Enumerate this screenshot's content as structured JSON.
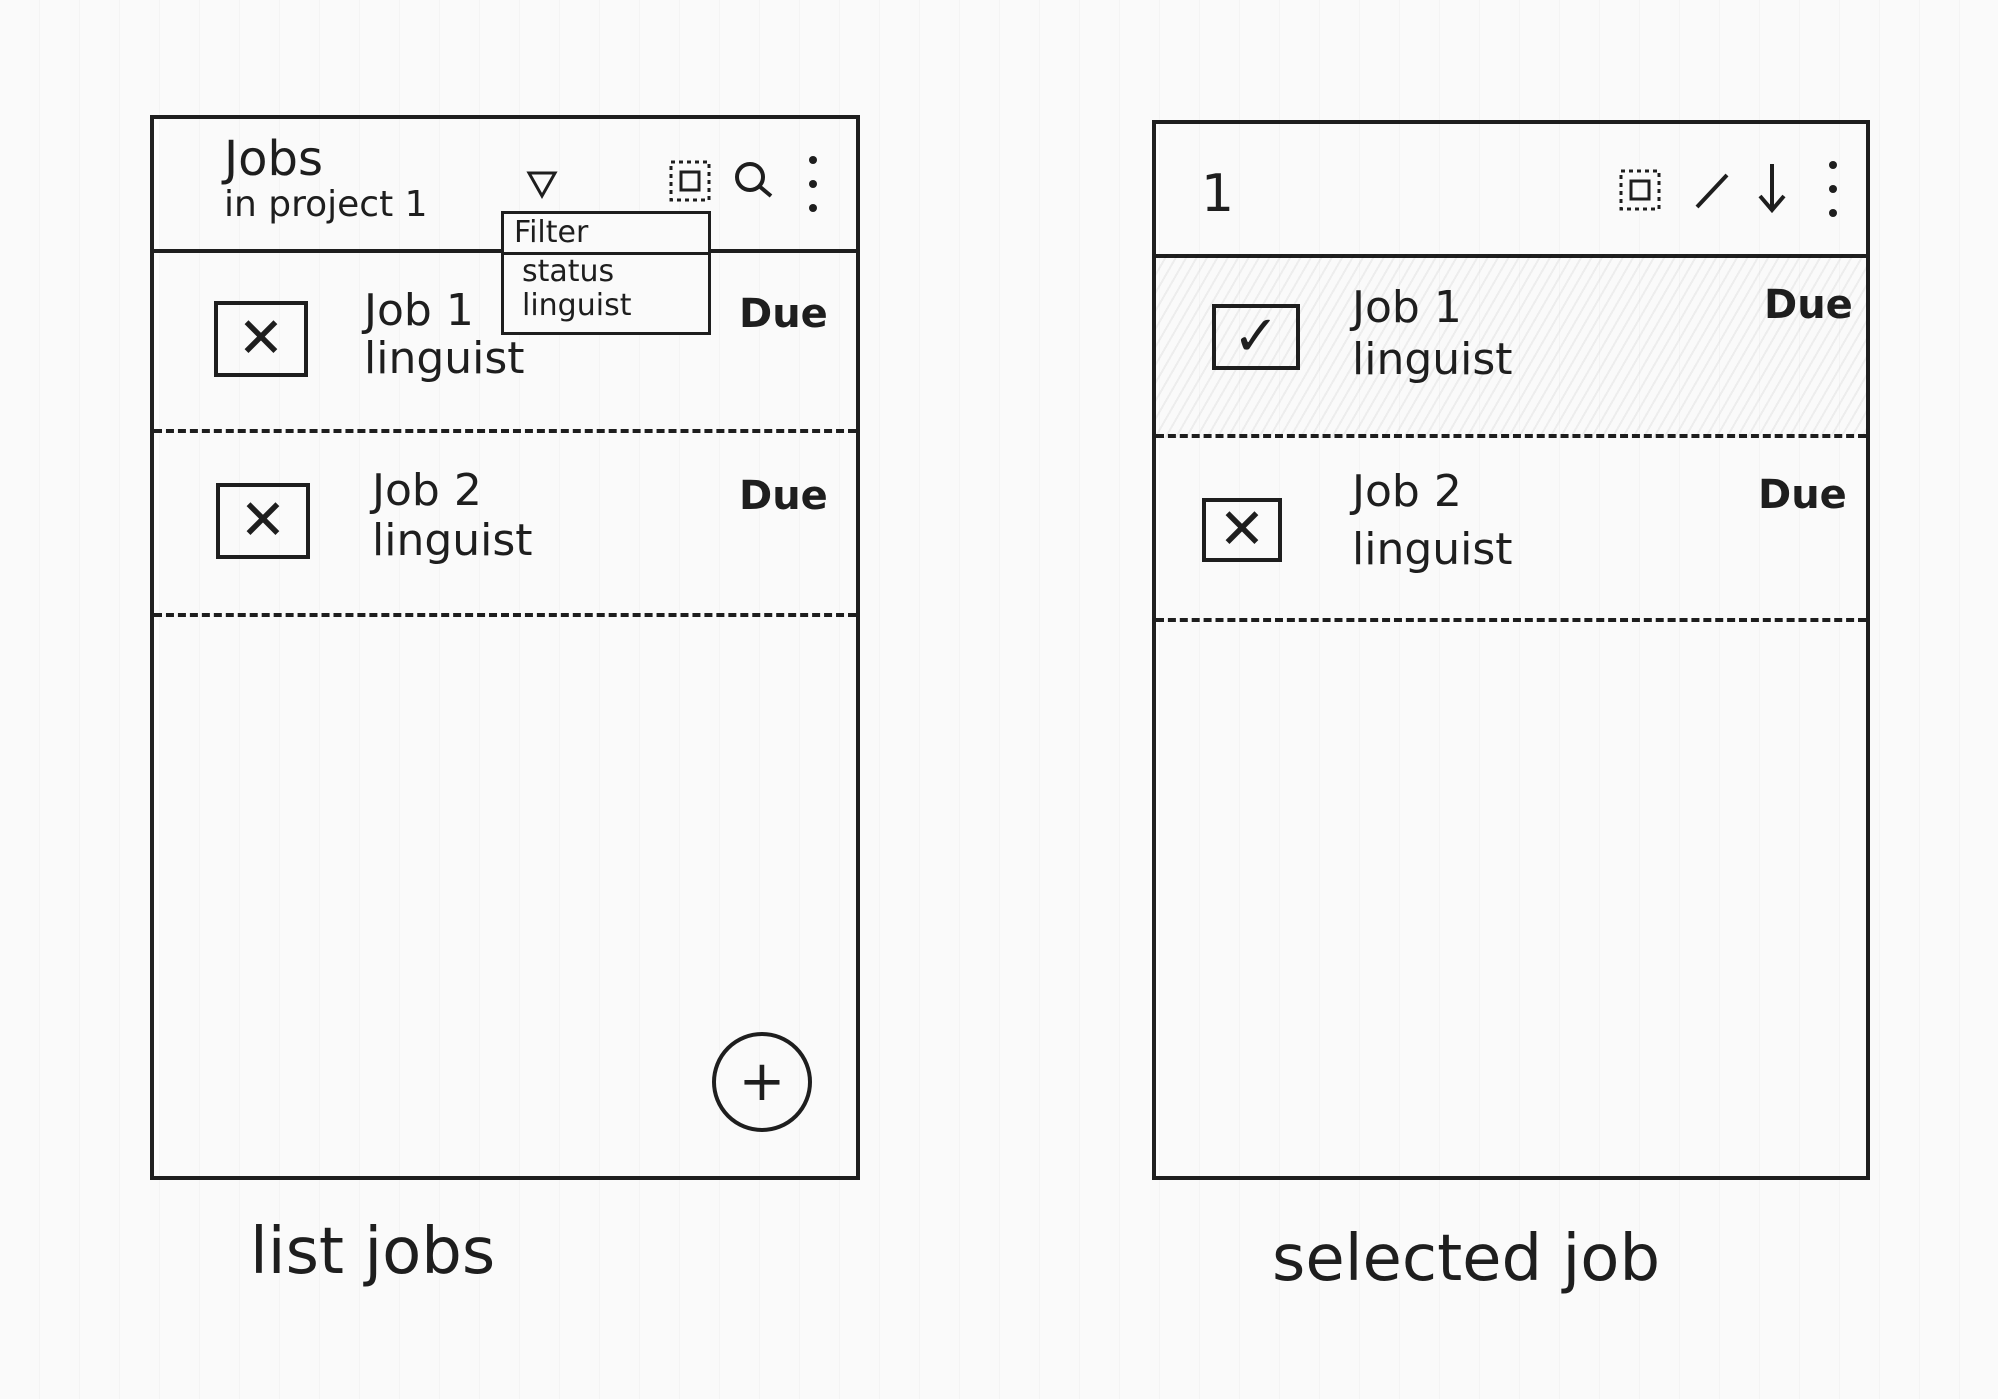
{
  "list_screen": {
    "header": {
      "title": "Jobs",
      "subtitle": "in project 1"
    },
    "filter_menu": {
      "heading": "Filter",
      "options": [
        "status",
        "linguist"
      ]
    },
    "jobs": [
      {
        "name": "Job 1",
        "role": "linguist",
        "due": "Due",
        "check": "✕"
      },
      {
        "name": "Job 2",
        "role": "linguist",
        "due": "Due",
        "check": "✕"
      }
    ],
    "fab_symbol": "+",
    "icons": [
      "filter-icon",
      "select-all-icon",
      "search-icon",
      "more-vert-icon"
    ]
  },
  "selected_screen": {
    "header": {
      "selected_count": "1"
    },
    "jobs": [
      {
        "name": "Job 1",
        "role": "linguist",
        "due": "Due",
        "check": "✓",
        "selected": true
      },
      {
        "name": "Job 2",
        "role": "linguist",
        "due": "Due",
        "check": "✕",
        "selected": false
      }
    ],
    "icons": [
      "select-all-icon",
      "edit-icon",
      "download-icon",
      "more-vert-icon"
    ]
  },
  "captions": {
    "left": "list jobs",
    "right": "selected job"
  }
}
